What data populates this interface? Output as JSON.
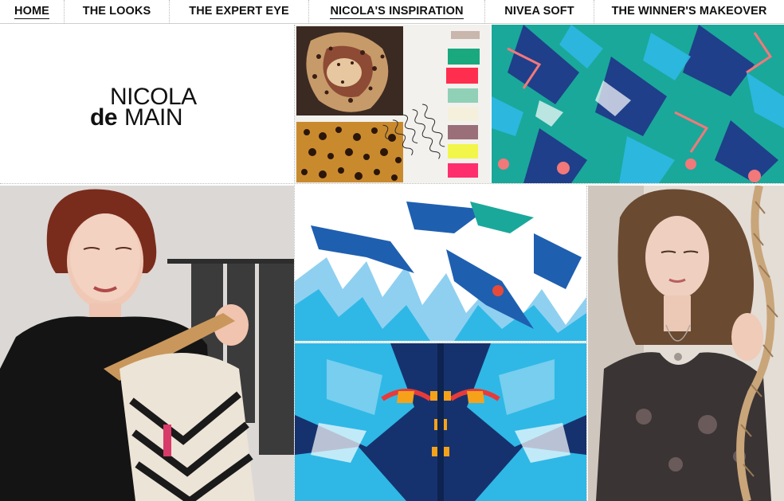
{
  "nav": {
    "items": [
      {
        "label": "HOME",
        "active": true
      },
      {
        "label": "THE LOOKS",
        "active": false
      },
      {
        "label": "THE EXPERT EYE",
        "active": false
      },
      {
        "label": "NICOLA'S INSPIRATION",
        "active": true
      },
      {
        "label": "NIVEA SOFT",
        "active": false
      },
      {
        "label": "THE WINNER'S MAKEOVER",
        "active": false
      }
    ]
  },
  "logo": {
    "line1": "NICOLA",
    "de": "de",
    "main": "MAIN"
  },
  "moodboard": {
    "handwriting": "arrange in leopard style with col"
  },
  "colors": {
    "teal": "#1aa89a",
    "sky": "#2fb8e6",
    "navy": "#1f3f8a",
    "coral": "#f2787a"
  }
}
